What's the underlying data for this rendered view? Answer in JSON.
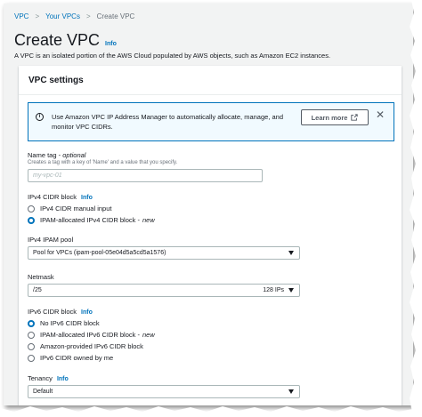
{
  "breadcrumb": {
    "items": [
      "VPC",
      "Your VPCs"
    ],
    "current": "Create VPC"
  },
  "page": {
    "title": "Create VPC",
    "info": "Info",
    "description": "A VPC is an isolated portion of the AWS Cloud populated by AWS objects, such as Amazon EC2 instances."
  },
  "panel": {
    "title": "VPC settings"
  },
  "alert": {
    "text": "Use Amazon VPC IP Address Manager to automatically allocate, manage, and monitor VPC CIDRs.",
    "button": "Learn more",
    "close": "✕"
  },
  "name_tag": {
    "label": "Name tag -",
    "optional": "optional",
    "hint": "Creates a tag with a key of 'Name' and a value that you specify.",
    "placeholder": "my-vpc-01"
  },
  "ipv4_block": {
    "label": "IPv4 CIDR block",
    "info": "Info",
    "options": [
      {
        "text": "IPv4 CIDR manual input",
        "new": ""
      },
      {
        "text": "IPAM-allocated IPv4 CIDR block -",
        "new": "new"
      }
    ]
  },
  "ipam_pool": {
    "label": "IPv4 IPAM pool",
    "value": "Pool for VPCs (ipam-pool-05e04d5a5cd5a1576)"
  },
  "netmask": {
    "label": "Netmask",
    "value": "/25",
    "suffix": "128 IPs"
  },
  "ipv6_block": {
    "label": "IPv6 CIDR block",
    "info": "Info",
    "options": [
      {
        "text": "No IPv6 CIDR block",
        "new": ""
      },
      {
        "text": "IPAM-allocated IPv6 CIDR block -",
        "new": "new"
      },
      {
        "text": "Amazon-provided IPv6 CIDR block",
        "new": ""
      },
      {
        "text": "IPv6 CIDR owned by me",
        "new": ""
      }
    ]
  },
  "tenancy": {
    "label": "Tenancy",
    "info": "Info",
    "value": "Default"
  },
  "colors": {
    "link": "#0073bb",
    "border": "#aab7b8",
    "alert_bg": "#f1faff"
  },
  "icons": {
    "alert": "info-circle-icon",
    "external": "external-link-icon",
    "close": "close-icon",
    "caret": "caret-down-icon"
  }
}
